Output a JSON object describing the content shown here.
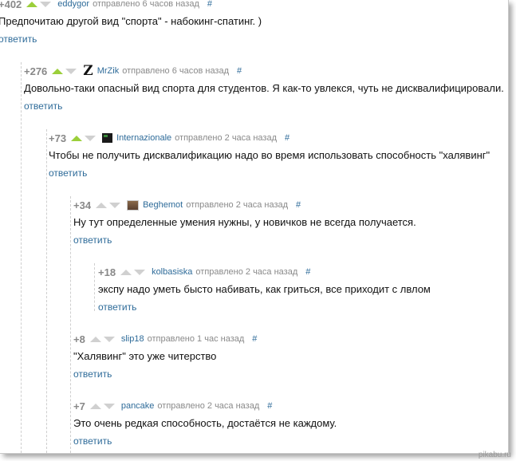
{
  "comments": [
    {
      "score": "+402",
      "author": "eddygor",
      "time": "отправлено 6 часов назад",
      "hash": "#",
      "text": "Предпочитаю другой вид \"спорта\" - набокинг-спатинг. )",
      "reply": "ответить",
      "avatar": "none",
      "upvoted": true
    },
    {
      "score": "+276",
      "author": "MrZik",
      "time": "отправлено 6 часов назад",
      "hash": "#",
      "text": "Довольно-таки опасный вид спорта для студентов. Я как-то увлекся, чуть не дисквалифицировали.",
      "reply": "ответить",
      "avatar": "Z",
      "upvoted": true
    },
    {
      "score": "+73",
      "author": "Internazionale",
      "time": "отправлено 2 часа назад",
      "hash": "#",
      "text": "Чтобы не получить дисквалификацию надо во время использовать способность \"халявинг\"",
      "reply": "ответить",
      "avatar": "box",
      "upvoted": true
    },
    {
      "score": "+34",
      "author": "Beghemot",
      "time": "отправлено 2 часа назад",
      "hash": "#",
      "text": "Ну тут определенные умения нужны, у новичков не всегда получается.",
      "reply": "ответить",
      "avatar": "img",
      "upvoted": false
    },
    {
      "score": "+18",
      "author": "kolbasiska",
      "time": "отправлено 2 часа назад",
      "hash": "#",
      "text": "экспу надо уметь бысто набивать, как гриться, все приходит с лвлом",
      "reply": "ответить",
      "avatar": "none",
      "upvoted": false
    },
    {
      "score": "+8",
      "author": "slip18",
      "time": "отправлено 1 час назад",
      "hash": "#",
      "text": "\"Халявинг\" это уже читерство",
      "reply": "ответить",
      "avatar": "none",
      "upvoted": false
    },
    {
      "score": "+7",
      "author": "pancake",
      "time": "отправлено 2 часа назад",
      "hash": "#",
      "text": "Это очень редкая способность, достаётся не каждому.",
      "reply": "ответить",
      "avatar": "none",
      "upvoted": false
    }
  ],
  "watermark": "pikabu.ru",
  "colors": {
    "link": "#2e6b99",
    "upvote_active": "#9bcf3a",
    "vote_inactive": "#d0d0d0"
  }
}
